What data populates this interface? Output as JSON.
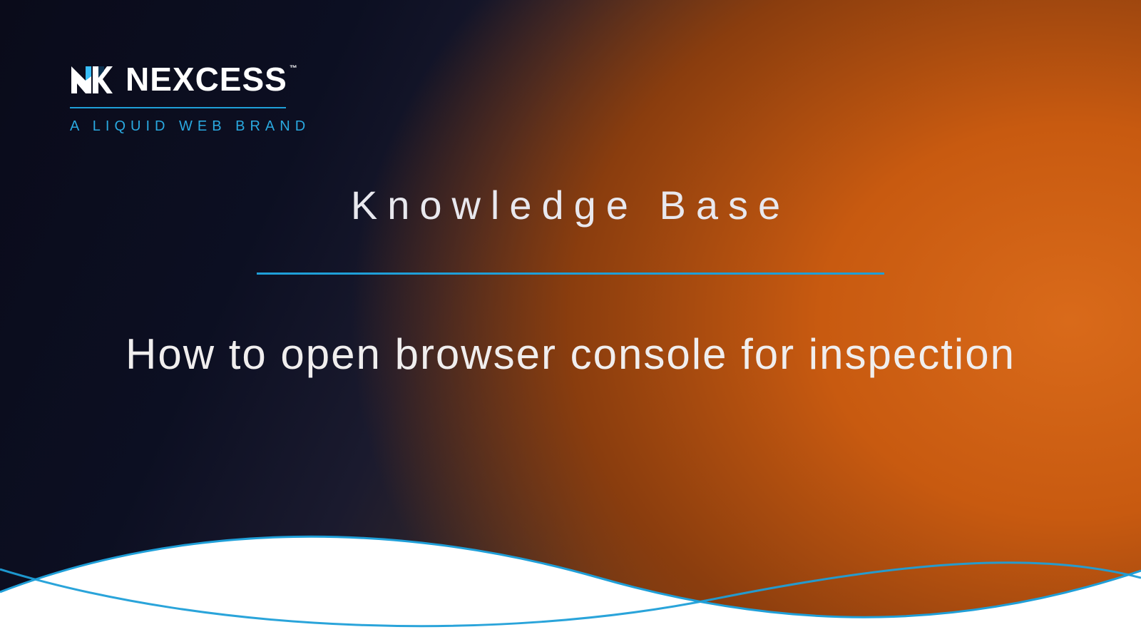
{
  "brand": {
    "name": "NEXCESS",
    "tm": "™",
    "tagline": "A  LIQUID  WEB  BRAND"
  },
  "header": {
    "section": "Knowledge Base"
  },
  "article": {
    "title": "How to open browser console for inspection"
  },
  "style": {
    "accent": "#1f9fd8",
    "accent_light": "#2aa9e0"
  }
}
